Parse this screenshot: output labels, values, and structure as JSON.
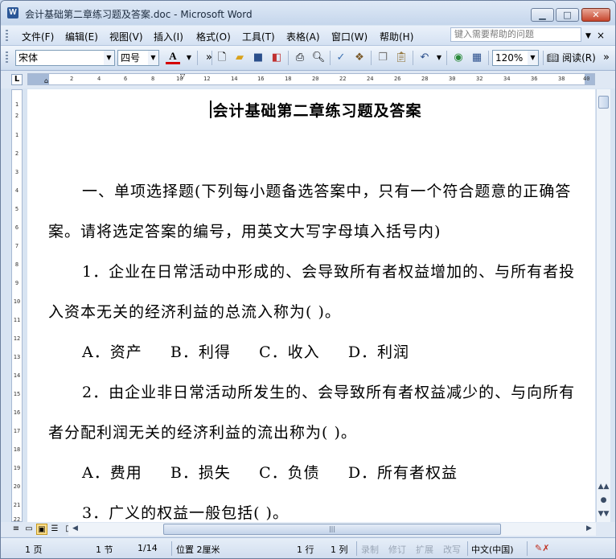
{
  "window": {
    "title": "会计基础第二章练习题及答案.doc - Microsoft Word",
    "minimize": "▁",
    "maximize": "□",
    "close": "✕"
  },
  "menu": {
    "items": [
      "文件(F)",
      "编辑(E)",
      "视图(V)",
      "插入(I)",
      "格式(O)",
      "工具(T)",
      "表格(A)",
      "窗口(W)",
      "帮助(H)"
    ],
    "help_placeholder": "键入需要帮助的问题",
    "doc_close": "×"
  },
  "toolbar": {
    "font_name": "宋体",
    "font_size": "四号",
    "font_color_label": "A",
    "zoom": "120%",
    "read_label": "阅读(R)"
  },
  "ruler": {
    "h_ticks": [
      "2",
      "4",
      "6",
      "8",
      "10",
      "12",
      "14",
      "16",
      "18",
      "20",
      "22",
      "24",
      "26",
      "28",
      "30",
      "32",
      "34",
      "36",
      "38",
      "40"
    ],
    "v_ticks": [
      "1",
      "2",
      "1",
      "2",
      "3",
      "4",
      "5",
      "6",
      "7",
      "8",
      "9",
      "10",
      "11",
      "12",
      "13",
      "14",
      "15",
      "16",
      "17",
      "18",
      "19",
      "20",
      "21",
      "22"
    ],
    "corner": "L"
  },
  "document": {
    "title": "会计基础第二章练习题及答案",
    "section1": "一、单项选择题(下列每小题备选答案中，只有一个符合题意的正确答案。请将选定答案的编号，用英文大写字母填入括号内)",
    "q1": "1．企业在日常活动中形成的、会导致所有者权益增加的、与所有者投入资本无关的经济利益的总流入称为(      )。",
    "q1_options": "A．资产     B．利得     C．收入     D．利润",
    "q2": "2．由企业非日常活动所发生的、会导致所有者权益减少的、与向所有者分配利润无关的经济利益的流出称为(      )。",
    "q2_options": "A．费用     B．损失     C．负债     D．所有者权益",
    "q3": "3．广义的权益一般包括(      )。"
  },
  "statusbar": {
    "page": "1 页",
    "section": "1 节",
    "page_of": "1/14",
    "position": "位置 2厘米",
    "line": "1 行",
    "column": "1 列",
    "rec": "录制",
    "trk": "修订",
    "ext": "扩展",
    "ovr": "改写",
    "language": "中文(中国)"
  }
}
